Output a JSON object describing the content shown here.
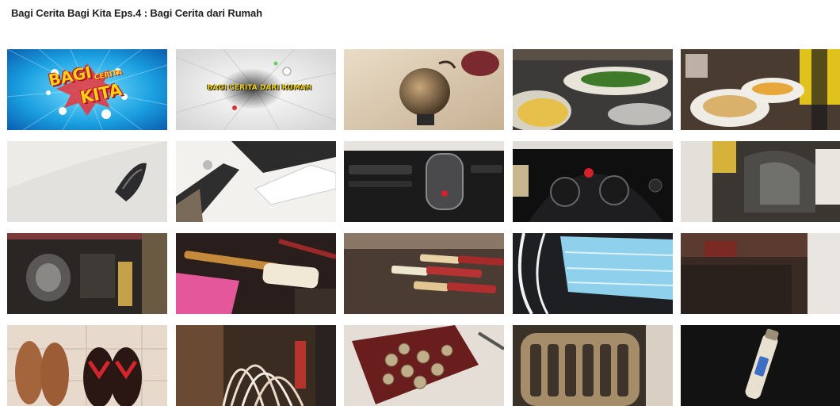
{
  "page": {
    "title": "Bagi Cerita Bagi Kita Eps.4 : Bagi Cerita dari Rumah"
  },
  "thumbnails": [
    {
      "row": 1,
      "col": 1,
      "subject": "title-card-logo",
      "caption_bagi": "BAGI",
      "caption_cerita": "CERITA",
      "caption_kita": "KITA"
    },
    {
      "row": 1,
      "col": 2,
      "subject": "title-card-episode",
      "caption": "BAGI CERITA DARI RUMAH"
    },
    {
      "row": 1,
      "col": 3,
      "subject": "kettle"
    },
    {
      "row": 1,
      "col": 4,
      "subject": "food-table"
    },
    {
      "row": 1,
      "col": 5,
      "subject": "meal-bowls"
    },
    {
      "row": 2,
      "col": 1,
      "subject": "car-headlight"
    },
    {
      "row": 2,
      "col": 2,
      "subject": "car-body"
    },
    {
      "row": 2,
      "col": 3,
      "subject": "car-dashboard"
    },
    {
      "row": 2,
      "col": 4,
      "subject": "car-instrument-cluster"
    },
    {
      "row": 2,
      "col": 5,
      "subject": "car-cabin"
    },
    {
      "row": 3,
      "col": 1,
      "subject": "bag-contents"
    },
    {
      "row": 3,
      "col": 2,
      "subject": "pouch-and-pen"
    },
    {
      "row": 3,
      "col": 3,
      "subject": "cigarettes"
    },
    {
      "row": 3,
      "col": 4,
      "subject": "face-masks"
    },
    {
      "row": 3,
      "col": 5,
      "subject": "dark-shelf"
    },
    {
      "row": 4,
      "col": 1,
      "subject": "sandals"
    },
    {
      "row": 4,
      "col": 2,
      "subject": "cables"
    },
    {
      "row": 4,
      "col": 3,
      "subject": "bottle-caps"
    },
    {
      "row": 4,
      "col": 4,
      "subject": "radiator-grille"
    },
    {
      "row": 4,
      "col": 5,
      "subject": "bottle"
    }
  ]
}
